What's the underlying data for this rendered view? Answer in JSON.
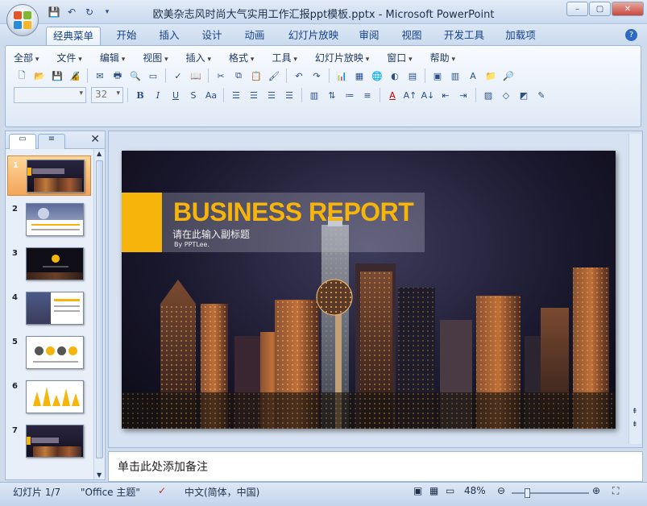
{
  "window": {
    "title": "欧美杂志风时尚大气实用工作汇报ppt模板.pptx - Microsoft PowerPoint",
    "controls": [
      "–",
      "▢",
      "✕"
    ]
  },
  "ribbon_tabs": [
    "经典菜单",
    "开始",
    "插入",
    "设计",
    "动画",
    "幻灯片放映",
    "审阅",
    "视图",
    "开发工具",
    "加载项"
  ],
  "classic_menu": [
    "全部",
    "文件",
    "编辑",
    "视图",
    "插入",
    "格式",
    "工具",
    "幻灯片放映",
    "窗口",
    "帮助"
  ],
  "font": {
    "name_value": "",
    "size_value": "32"
  },
  "slide": {
    "title": "BUSINESS REPORT",
    "subtitle": "请在此输入副标题",
    "byline": "By PPTLee.",
    "accent_color": "#f7b50c"
  },
  "thumbnails": [
    "1",
    "2",
    "3",
    "4",
    "5",
    "6",
    "7"
  ],
  "notes_placeholder": "单击此处添加备注",
  "status": {
    "slide_counter": "幻灯片 1/7",
    "theme": "\"Office 主题\"",
    "language": "中文(简体，中国)",
    "zoom": "48%"
  }
}
